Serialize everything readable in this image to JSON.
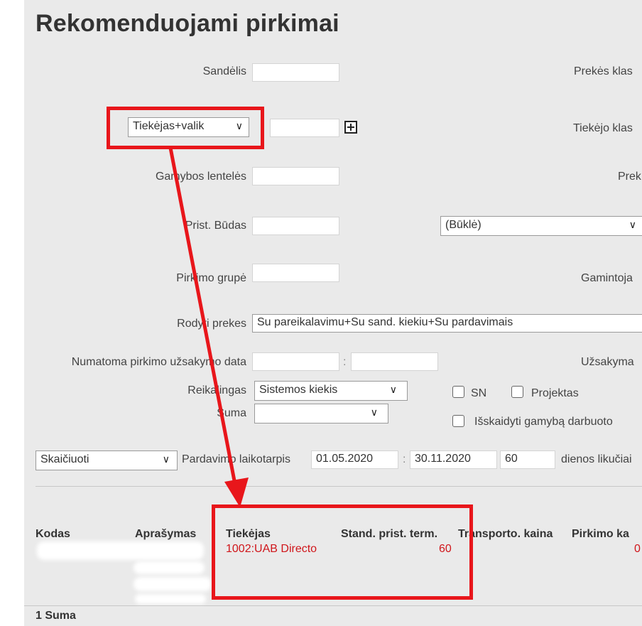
{
  "page": {
    "title": "Rekomenduojami pirkimai"
  },
  "filters": {
    "warehouse_label": "Sandėlis",
    "item_class_label": "Prekės klas",
    "supplier_mode_select": "Tiekėjas+valik",
    "supplier_class_label": "Tiekėjo klas",
    "production_tables_label": "Gamybos lentelės",
    "item_label": "Prek",
    "delivery_method_label": "Prist. Būdas",
    "status_select": "(Būklė)",
    "purchase_group_label": "Pirkimo grupė",
    "manufacturer_label": "Gamintoja",
    "show_items_label": "Rodyti prekes",
    "show_items_value": "Su pareikalavimu+Su sand. kiekiu+Su pardavimais",
    "expected_order_date_label": "Numatoma pirkimo užsakymo data",
    "order_label": "Užsakyma",
    "date_separator": ":",
    "need_label": "Reikalingas",
    "need_select": "Sistemos kiekis",
    "sn_label": "SN",
    "projects_label": "Projektas",
    "sum_label": "Suma",
    "sum_select": "",
    "split_production_label": "Išskaidyti gamybą darbuoto"
  },
  "calc": {
    "action_select": "Skaičiuoti",
    "sales_period_label": "Pardavimo laikotarpis",
    "date_from": "01.05.2020",
    "separator": ":",
    "date_to": "30.11.2020",
    "days": "60",
    "days_suffix": "dienos likučiai"
  },
  "table": {
    "headers": {
      "code": "Kodas",
      "description": "Aprašymas",
      "supplier": "Tiekėjas",
      "std_delivery": "Stand. prist. term.",
      "transport": "Transporto. kaina",
      "purchase": "Pirkimo ka"
    },
    "row": {
      "supplier": "1002:UAB Directo",
      "std_delivery": "60",
      "purchase": "0"
    },
    "footer": "1 Suma"
  },
  "colors": {
    "annotation": "#e8161b",
    "row_text": "#d0161b",
    "panel": "#eaeaea"
  }
}
